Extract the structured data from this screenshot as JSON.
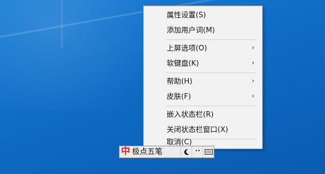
{
  "context_menu": {
    "items": [
      {
        "label": "属性设置(S)",
        "has_submenu": false
      },
      {
        "label": "添加用户词(M)",
        "has_submenu": false
      },
      {
        "label": "上屏选项(O)",
        "has_submenu": true
      },
      {
        "label": "软键盘(K)",
        "has_submenu": true
      },
      {
        "label": "帮助(H)",
        "has_submenu": true
      },
      {
        "label": "皮肤(F)",
        "has_submenu": true
      },
      {
        "label": "嵌入状态栏(R)",
        "has_submenu": false
      },
      {
        "label": "关闭状态栏窗口(X)",
        "has_submenu": false
      },
      {
        "label": "取消(C)",
        "has_submenu": false
      }
    ]
  },
  "ime_bar": {
    "logo": "中",
    "name": "极点五笔",
    "icons": [
      "moon-icon",
      "punctuation-icon",
      "keyboard-icon"
    ]
  },
  "icons": {
    "submenu_arrow": "chevron-right-icon"
  },
  "colors": {
    "desktop": "#0f6cc4",
    "menu_bg": "#f2f2f2",
    "menu_border": "#a8a8a8",
    "logo_red": "#d71f1f"
  }
}
